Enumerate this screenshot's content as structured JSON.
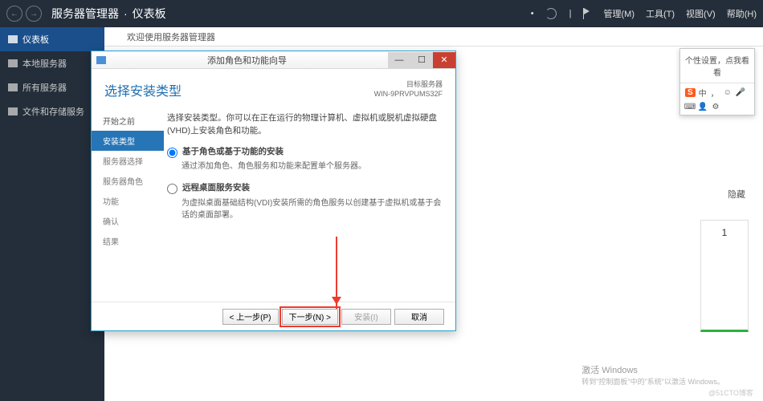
{
  "titlebar": {
    "breadcrumb1": "服务器管理器",
    "breadcrumb_sep": "·",
    "breadcrumb2": "仪表板",
    "menu": {
      "manage": "管理(M)",
      "tools": "工具(T)",
      "view": "视图(V)",
      "help": "帮助(H)"
    }
  },
  "sidebar": {
    "dashboard": "仪表板",
    "local": "本地服务器",
    "all": "所有服务器",
    "files": "文件和存储服务"
  },
  "content": {
    "welcome": "欢迎使用服务器管理器",
    "hidden": "隐藏",
    "tile_value": "1"
  },
  "dialog": {
    "title": "添加角色和功能向导",
    "heading": "选择安装类型",
    "target_label": "目标服务器",
    "target_name": "WIN-9PRVPUMS32F",
    "steps": {
      "before": "开始之前",
      "type": "安装类型",
      "server": "服务器选择",
      "roles": "服务器角色",
      "features": "功能",
      "confirm": "确认",
      "result": "结果"
    },
    "desc": "选择安装类型。你可以在正在运行的物理计算机、虚拟机或脱机虚拟硬盘(VHD)上安装角色和功能。",
    "opt1_label": "基于角色或基于功能的安装",
    "opt1_sub": "通过添加角色、角色服务和功能来配置单个服务器。",
    "opt2_label": "远程桌面服务安装",
    "opt2_sub": "为虚拟桌面基础结构(VDI)安装所需的角色服务以创建基于虚拟机或基于会话的桌面部署。",
    "buttons": {
      "prev": "< 上一步(P)",
      "next": "下一步(N) >",
      "install": "安装(I)",
      "cancel": "取消"
    }
  },
  "floater": {
    "head": "个性设置，点我看看",
    "ime": "中",
    "sogou": "S"
  },
  "activate": {
    "title": "激活 Windows",
    "sub": "转到\"控制面板\"中的\"系统\"以激活 Windows。"
  },
  "watermark": "@51CTO博客"
}
